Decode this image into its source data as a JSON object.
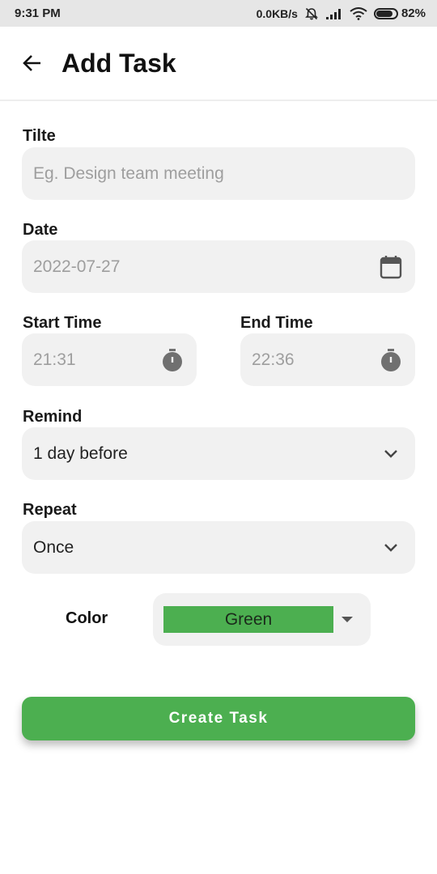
{
  "status_bar": {
    "time": "9:31 PM",
    "network_speed": "0.0KB/s",
    "battery_percent": "82%",
    "battery_level": 0.82,
    "icons": [
      "alarm-off-icon",
      "signal-icon",
      "wifi-icon",
      "battery-icon"
    ]
  },
  "header": {
    "back_icon": "arrow-left-icon",
    "title": "Add Task"
  },
  "form": {
    "title": {
      "label": "Tilte",
      "placeholder": "Eg. Design team meeting"
    },
    "date": {
      "label": "Date",
      "value": "2022-07-27",
      "icon": "calendar-icon"
    },
    "start_time": {
      "label": "Start Time",
      "value": "21:31",
      "icon": "stopwatch-icon"
    },
    "end_time": {
      "label": "End Time",
      "value": "22:36",
      "icon": "stopwatch-icon"
    },
    "remind": {
      "label": "Remind",
      "value": "1 day before",
      "icon": "chevron-down-icon"
    },
    "repeat": {
      "label": "Repeat",
      "value": "Once",
      "icon": "chevron-down-icon"
    },
    "color": {
      "label": "Color",
      "value": "Green",
      "swatch": "#4caf50",
      "icon": "caret-down-icon"
    }
  },
  "actions": {
    "create_label": "Create Task"
  },
  "colors": {
    "accent": "#4caf50",
    "field_bg": "#f1f1f1",
    "placeholder": "#9e9e9e",
    "status_bar_bg": "#e6e6e6"
  }
}
